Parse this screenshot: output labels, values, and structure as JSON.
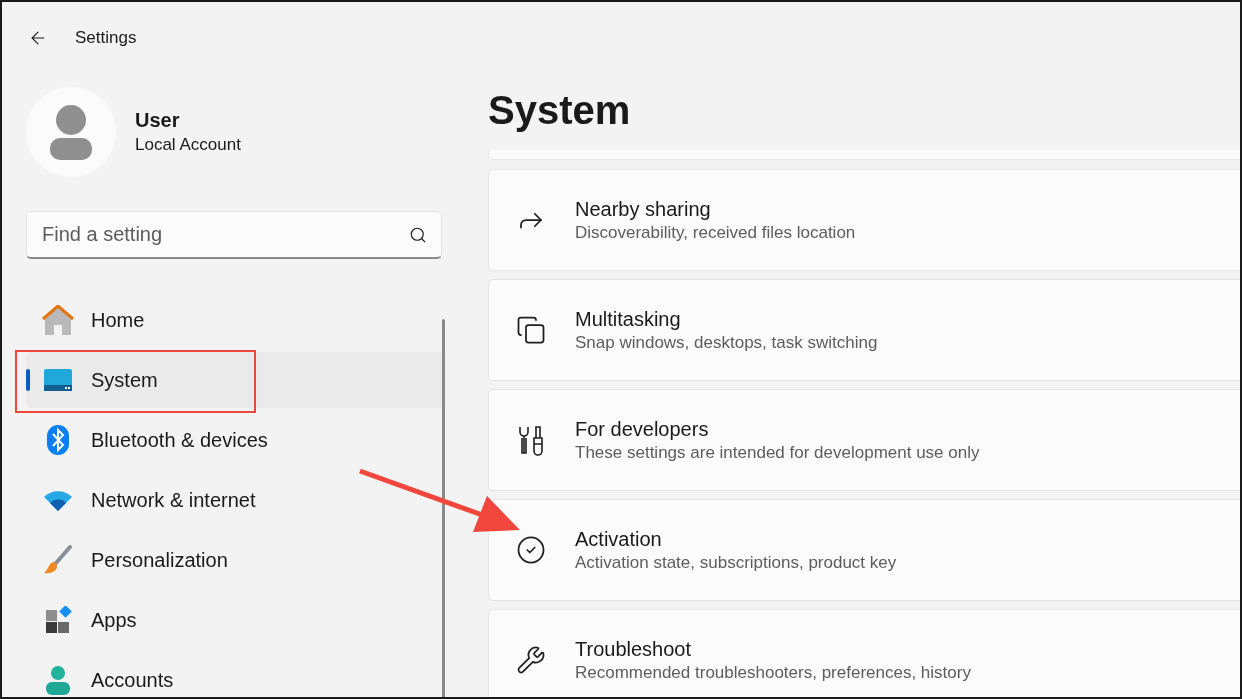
{
  "window": {
    "title": "Settings"
  },
  "profile": {
    "name": "User",
    "account": "Local Account"
  },
  "search": {
    "placeholder": "Find a setting"
  },
  "nav": [
    {
      "kind": "home",
      "label": "Home",
      "selected": false
    },
    {
      "kind": "system",
      "label": "System",
      "selected": true
    },
    {
      "kind": "bluetooth",
      "label": "Bluetooth & devices",
      "selected": false
    },
    {
      "kind": "network",
      "label": "Network & internet",
      "selected": false
    },
    {
      "kind": "personalization",
      "label": "Personalization",
      "selected": false
    },
    {
      "kind": "apps",
      "label": "Apps",
      "selected": false
    },
    {
      "kind": "accounts",
      "label": "Accounts",
      "selected": false
    }
  ],
  "page_title": "System",
  "cards": [
    {
      "kind": "share",
      "title": "Nearby sharing",
      "subtitle": "Discoverability, received files location"
    },
    {
      "kind": "multitask",
      "title": "Multitasking",
      "subtitle": "Snap windows, desktops, task switching"
    },
    {
      "kind": "developer",
      "title": "For developers",
      "subtitle": "These settings are intended for development use only"
    },
    {
      "kind": "activation",
      "title": "Activation",
      "subtitle": "Activation state, subscriptions, product key"
    },
    {
      "kind": "troubleshoot",
      "title": "Troubleshoot",
      "subtitle": "Recommended troubleshooters, preferences, history"
    }
  ]
}
